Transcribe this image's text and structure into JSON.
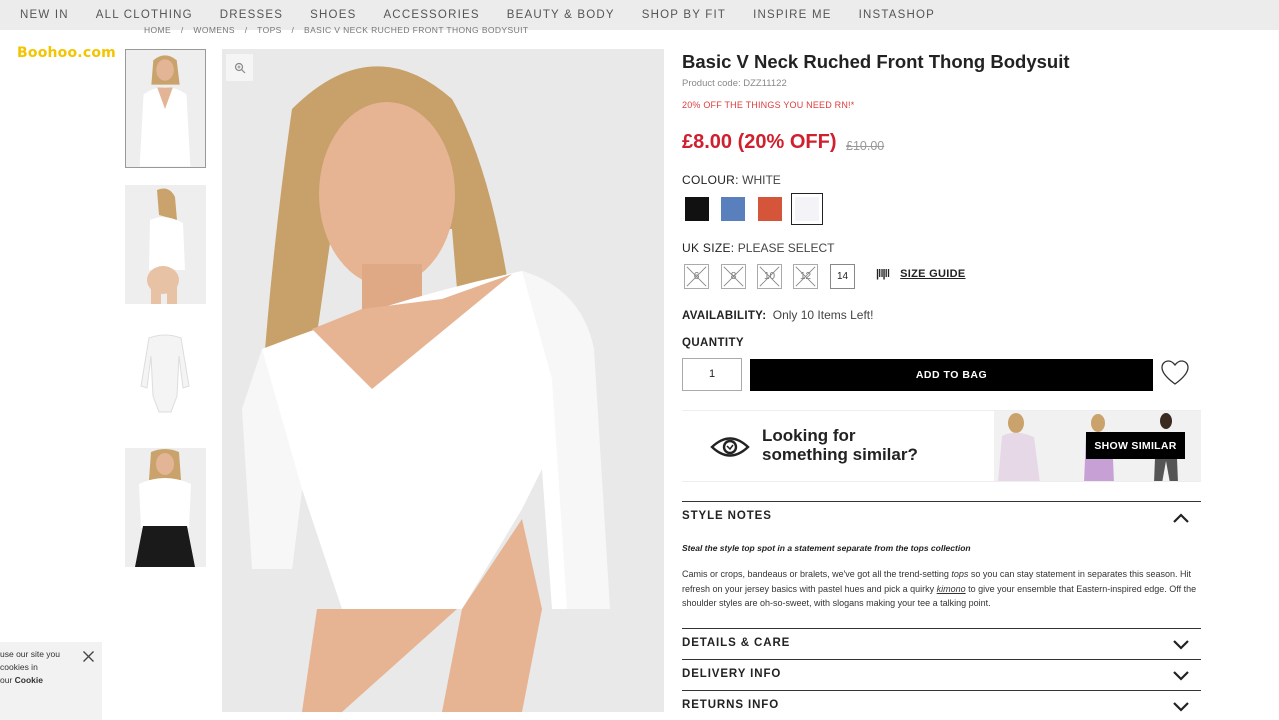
{
  "nav": {
    "items": [
      "NEW IN",
      "ALL CLOTHING",
      "DRESSES",
      "SHOES",
      "ACCESSORIES",
      "BEAUTY & BODY",
      "SHOP BY FIT",
      "INSPIRE ME",
      "INSTASHOP"
    ]
  },
  "brand": {
    "logo": "Boohoo.com"
  },
  "breadcrumb": [
    "HOME",
    "/",
    "WOMENS",
    "/",
    "TOPS",
    "/",
    "BASIC V NECK RUCHED FRONT THONG BODYSUIT"
  ],
  "product": {
    "title": "Basic V Neck Ruched Front Thong Bodysuit",
    "code": "Product code: DZZ11122",
    "promo": "20% OFF THE THINGS YOU NEED RN!*",
    "price": "£8.00 (20% OFF)",
    "old_price": "£10.00",
    "colour_label": "COLOUR:",
    "colour_value": "WHITE",
    "colours": [
      {
        "name": "black",
        "hex": "#111111"
      },
      {
        "name": "blue",
        "hex": "#5a7fbd"
      },
      {
        "name": "rust",
        "hex": "#d4553a"
      },
      {
        "name": "white",
        "hex": "#f4f4f8",
        "selected": true
      }
    ],
    "size_label": "UK SIZE:",
    "size_value": "PLEASE SELECT",
    "sizes": [
      {
        "label": "6",
        "available": false
      },
      {
        "label": "8",
        "available": false
      },
      {
        "label": "10",
        "available": false
      },
      {
        "label": "12",
        "available": false
      },
      {
        "label": "14",
        "available": true
      }
    ],
    "size_guide": "SIZE GUIDE",
    "size_guide_icon": "ruler-icon",
    "availability_label": "AVAILABILITY:",
    "availability_value": "Only 10 Items Left!",
    "quantity_label": "QUANTITY",
    "quantity_value": "1",
    "add_to_bag": "ADD TO BAG",
    "wishlist_icon": "heart-icon"
  },
  "similar": {
    "line1": "Looking for",
    "line2": "something similar?",
    "button": "SHOW SIMILAR",
    "icon": "eye-icon"
  },
  "style_notes": {
    "title": "STYLE NOTES",
    "lead": "Steal the style top spot in a statement separate from the tops collection",
    "body_1": "Camis or crops, bandeaus or bralets, we've got all the trend-setting ",
    "body_tops": "tops",
    "body_2": " so you can stay statement in separates this season. Hit refresh on your jersey basics with pastel hues and pick a quirky ",
    "body_kimono": "kimono",
    "body_3": " to give your ensemble that Eastern-inspired edge. Off the shoulder styles are oh-so-sweet, with slogans making your tee a talking point."
  },
  "accordions": {
    "details": "DETAILS & CARE",
    "delivery": "DELIVERY INFO",
    "returns": "RETURNS INFO"
  },
  "cookie": {
    "line1": "use our site you",
    "line2": "cookies in",
    "line3_prefix": "our ",
    "line3_bold": "Cookie"
  },
  "colors": {
    "accent_red": "#d0202e",
    "logo_yellow": "#f5c400",
    "nav_bg": "#ececec"
  }
}
